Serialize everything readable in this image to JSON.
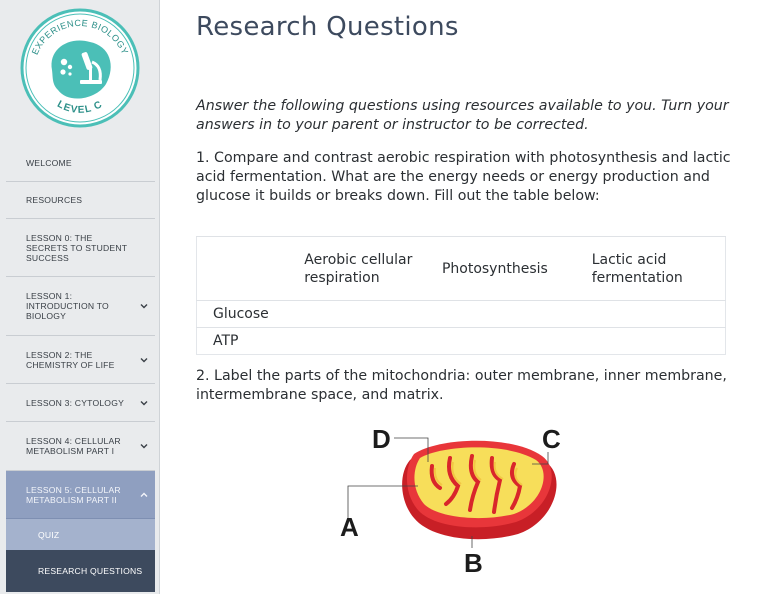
{
  "logo": {
    "top_text": "EXPERIENCE BIOLOGY",
    "bottom_text": "LEVEL C",
    "colors": {
      "ring": "#4bbfb7",
      "blob": "#4bbfb7",
      "text": "#2b8f88"
    }
  },
  "sidebar": {
    "items": [
      {
        "label": "WELCOME",
        "expandable": false
      },
      {
        "label": "RESOURCES",
        "expandable": false
      },
      {
        "label": "LESSON 0: THE SECRETS TO STUDENT SUCCESS",
        "expandable": false
      },
      {
        "label": "LESSON 1: INTRODUCTION TO BIOLOGY",
        "expandable": true
      },
      {
        "label": "LESSON 2: THE CHEMISTRY OF LIFE",
        "expandable": true
      },
      {
        "label": "LESSON 3: CYTOLOGY",
        "expandable": true
      },
      {
        "label": "LESSON 4: CELLULAR METABOLISM PART I",
        "expandable": true
      },
      {
        "label": "LESSON 5: CELLULAR METABOLISM PART II",
        "expandable": true,
        "expanded": true
      }
    ],
    "subitems": [
      {
        "label": "QUIZ"
      },
      {
        "label": "RESEARCH QUESTIONS",
        "current": true
      }
    ],
    "colors": {
      "active_parent": "#8f9fc0",
      "quiz": "#a4b2cd",
      "current": "#3d4a5e"
    }
  },
  "main": {
    "title": "Research Questions",
    "intro": "Answer the following questions using resources available to you. Turn your answers in to your parent or instructor to be corrected.",
    "q1": "1. Compare and contrast aerobic respiration with photosynthesis and lactic acid fermentation. What are the energy needs or energy production and glucose it builds or breaks down. Fill out the table below:",
    "table": {
      "headers": [
        "",
        "Aerobic cellular respiration",
        "Photosynthesis",
        "Lactic acid fermentation"
      ],
      "rows": [
        [
          "Glucose",
          "",
          "",
          ""
        ],
        [
          "ATP",
          "",
          "",
          ""
        ]
      ]
    },
    "q2": "2. Label the parts of the mitochondria: outer membrane, inner membrane, intermembrane space, and matrix.",
    "diagram": {
      "labels": [
        "D",
        "C",
        "A",
        "B"
      ],
      "colors": {
        "outer": "#d9262b",
        "inner_fold": "#f2c744",
        "matrix": "#f7de5a"
      }
    }
  }
}
